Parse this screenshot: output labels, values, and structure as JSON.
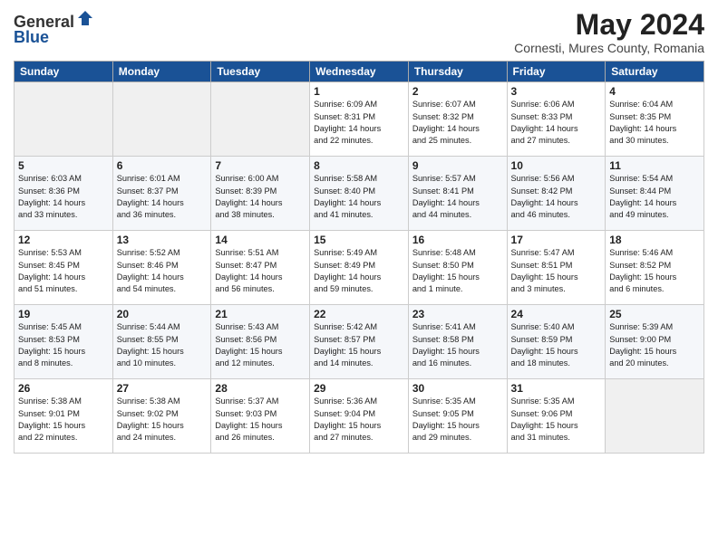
{
  "logo": {
    "general": "General",
    "blue": "Blue"
  },
  "title": {
    "month_year": "May 2024",
    "location": "Cornesti, Mures County, Romania"
  },
  "weekdays": [
    "Sunday",
    "Monday",
    "Tuesday",
    "Wednesday",
    "Thursday",
    "Friday",
    "Saturday"
  ],
  "weeks": [
    [
      {
        "day": "",
        "info": ""
      },
      {
        "day": "",
        "info": ""
      },
      {
        "day": "",
        "info": ""
      },
      {
        "day": "1",
        "info": "Sunrise: 6:09 AM\nSunset: 8:31 PM\nDaylight: 14 hours\nand 22 minutes."
      },
      {
        "day": "2",
        "info": "Sunrise: 6:07 AM\nSunset: 8:32 PM\nDaylight: 14 hours\nand 25 minutes."
      },
      {
        "day": "3",
        "info": "Sunrise: 6:06 AM\nSunset: 8:33 PM\nDaylight: 14 hours\nand 27 minutes."
      },
      {
        "day": "4",
        "info": "Sunrise: 6:04 AM\nSunset: 8:35 PM\nDaylight: 14 hours\nand 30 minutes."
      }
    ],
    [
      {
        "day": "5",
        "info": "Sunrise: 6:03 AM\nSunset: 8:36 PM\nDaylight: 14 hours\nand 33 minutes."
      },
      {
        "day": "6",
        "info": "Sunrise: 6:01 AM\nSunset: 8:37 PM\nDaylight: 14 hours\nand 36 minutes."
      },
      {
        "day": "7",
        "info": "Sunrise: 6:00 AM\nSunset: 8:39 PM\nDaylight: 14 hours\nand 38 minutes."
      },
      {
        "day": "8",
        "info": "Sunrise: 5:58 AM\nSunset: 8:40 PM\nDaylight: 14 hours\nand 41 minutes."
      },
      {
        "day": "9",
        "info": "Sunrise: 5:57 AM\nSunset: 8:41 PM\nDaylight: 14 hours\nand 44 minutes."
      },
      {
        "day": "10",
        "info": "Sunrise: 5:56 AM\nSunset: 8:42 PM\nDaylight: 14 hours\nand 46 minutes."
      },
      {
        "day": "11",
        "info": "Sunrise: 5:54 AM\nSunset: 8:44 PM\nDaylight: 14 hours\nand 49 minutes."
      }
    ],
    [
      {
        "day": "12",
        "info": "Sunrise: 5:53 AM\nSunset: 8:45 PM\nDaylight: 14 hours\nand 51 minutes."
      },
      {
        "day": "13",
        "info": "Sunrise: 5:52 AM\nSunset: 8:46 PM\nDaylight: 14 hours\nand 54 minutes."
      },
      {
        "day": "14",
        "info": "Sunrise: 5:51 AM\nSunset: 8:47 PM\nDaylight: 14 hours\nand 56 minutes."
      },
      {
        "day": "15",
        "info": "Sunrise: 5:49 AM\nSunset: 8:49 PM\nDaylight: 14 hours\nand 59 minutes."
      },
      {
        "day": "16",
        "info": "Sunrise: 5:48 AM\nSunset: 8:50 PM\nDaylight: 15 hours\nand 1 minute."
      },
      {
        "day": "17",
        "info": "Sunrise: 5:47 AM\nSunset: 8:51 PM\nDaylight: 15 hours\nand 3 minutes."
      },
      {
        "day": "18",
        "info": "Sunrise: 5:46 AM\nSunset: 8:52 PM\nDaylight: 15 hours\nand 6 minutes."
      }
    ],
    [
      {
        "day": "19",
        "info": "Sunrise: 5:45 AM\nSunset: 8:53 PM\nDaylight: 15 hours\nand 8 minutes."
      },
      {
        "day": "20",
        "info": "Sunrise: 5:44 AM\nSunset: 8:55 PM\nDaylight: 15 hours\nand 10 minutes."
      },
      {
        "day": "21",
        "info": "Sunrise: 5:43 AM\nSunset: 8:56 PM\nDaylight: 15 hours\nand 12 minutes."
      },
      {
        "day": "22",
        "info": "Sunrise: 5:42 AM\nSunset: 8:57 PM\nDaylight: 15 hours\nand 14 minutes."
      },
      {
        "day": "23",
        "info": "Sunrise: 5:41 AM\nSunset: 8:58 PM\nDaylight: 15 hours\nand 16 minutes."
      },
      {
        "day": "24",
        "info": "Sunrise: 5:40 AM\nSunset: 8:59 PM\nDaylight: 15 hours\nand 18 minutes."
      },
      {
        "day": "25",
        "info": "Sunrise: 5:39 AM\nSunset: 9:00 PM\nDaylight: 15 hours\nand 20 minutes."
      }
    ],
    [
      {
        "day": "26",
        "info": "Sunrise: 5:38 AM\nSunset: 9:01 PM\nDaylight: 15 hours\nand 22 minutes."
      },
      {
        "day": "27",
        "info": "Sunrise: 5:38 AM\nSunset: 9:02 PM\nDaylight: 15 hours\nand 24 minutes."
      },
      {
        "day": "28",
        "info": "Sunrise: 5:37 AM\nSunset: 9:03 PM\nDaylight: 15 hours\nand 26 minutes."
      },
      {
        "day": "29",
        "info": "Sunrise: 5:36 AM\nSunset: 9:04 PM\nDaylight: 15 hours\nand 27 minutes."
      },
      {
        "day": "30",
        "info": "Sunrise: 5:35 AM\nSunset: 9:05 PM\nDaylight: 15 hours\nand 29 minutes."
      },
      {
        "day": "31",
        "info": "Sunrise: 5:35 AM\nSunset: 9:06 PM\nDaylight: 15 hours\nand 31 minutes."
      },
      {
        "day": "",
        "info": ""
      }
    ]
  ]
}
